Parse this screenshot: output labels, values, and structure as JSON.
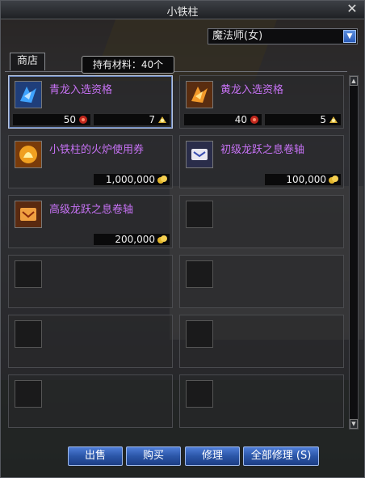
{
  "window": {
    "title": "小铁柱",
    "close_icon": "close-icon"
  },
  "class_filter": {
    "selected": "魔法师(女)"
  },
  "tabs": [
    {
      "label": "商店"
    }
  ],
  "tooltip": {
    "text": "持有材料：40个"
  },
  "items": [
    {
      "name": "青龙入选资格",
      "icon": "blue-dragon-ticket-icon",
      "cost_a": "50",
      "cost_b": "7",
      "selected": true
    },
    {
      "name": "黄龙入选资格",
      "icon": "yellow-dragon-ticket-icon",
      "cost_a": "40",
      "cost_b": "5"
    },
    {
      "name": "小铁柱的火炉使用券",
      "icon": "furnace-ticket-icon",
      "price": "1,000,000"
    },
    {
      "name": "初级龙跃之息卷轴",
      "icon": "basic-dragon-scroll-icon",
      "price": "100,000"
    },
    {
      "name": "高级龙跃之息卷轴",
      "icon": "advanced-dragon-scroll-icon",
      "price": "200,000"
    }
  ],
  "buttons": {
    "sell": "出售",
    "buy": "购买",
    "repair": "修理",
    "repair_all": "全部修理 (S)"
  },
  "colors": {
    "item_name": "#c772f5",
    "button": "#2b56a8"
  }
}
